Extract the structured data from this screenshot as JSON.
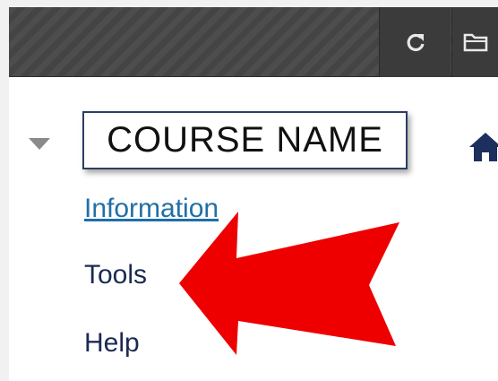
{
  "course": {
    "name": "COURSE NAME"
  },
  "menu": {
    "items": [
      {
        "label": "Information"
      },
      {
        "label": "Tools"
      },
      {
        "label": "Help"
      }
    ]
  },
  "topbar": {
    "refresh_icon": "refresh-icon",
    "folder_icon": "folder-icon"
  },
  "icons": {
    "home": "home-icon",
    "toggle": "triangle-down-icon"
  },
  "colors": {
    "topbar": "#454545",
    "course_border": "#2c3e64",
    "link": "#1f6fa8",
    "nav_text": "#1a2a52",
    "arrow": "#ee0000"
  }
}
